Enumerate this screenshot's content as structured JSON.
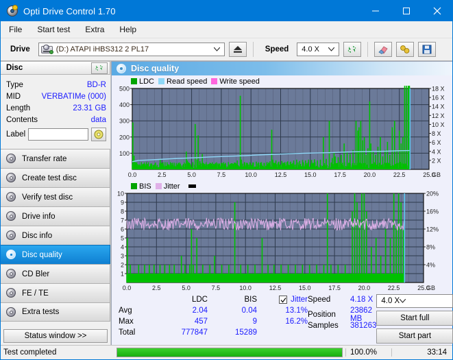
{
  "window": {
    "title": "Opti Drive Control 1.70",
    "icon": "disc-icon",
    "minimize": "–",
    "maximize": "□",
    "close": "✕"
  },
  "menu": {
    "items": [
      "File",
      "Start test",
      "Extra",
      "Help"
    ]
  },
  "toolbar": {
    "drive_label": "Drive",
    "drive_value": "(D:)  ATAPI iHBS312  2 PL17",
    "eject_icon": "eject-icon",
    "speed_label": "Speed",
    "speed_value": "4.0 X",
    "refresh_icon": "refresh-icon",
    "erase_icon": "eraser-icon",
    "key_icon": "key-icon",
    "save_icon": "save-icon"
  },
  "disc": {
    "header": "Disc",
    "refresh_icon": "refresh-icon",
    "rows": [
      {
        "key": "Type",
        "value": "BD-R"
      },
      {
        "key": "MID",
        "value": "VERBATIMe (000)"
      },
      {
        "key": "Length",
        "value": "23.31 GB"
      },
      {
        "key": "Contents",
        "value": "data"
      }
    ],
    "label_key": "Label",
    "label_value": "",
    "label_icon": "cd-icon"
  },
  "sidebar": {
    "items": [
      {
        "label": "Transfer rate",
        "active": false
      },
      {
        "label": "Create test disc",
        "active": false
      },
      {
        "label": "Verify test disc",
        "active": false
      },
      {
        "label": "Drive info",
        "active": false
      },
      {
        "label": "Disc info",
        "active": false
      },
      {
        "label": "Disc quality",
        "active": true
      },
      {
        "label": "CD Bler",
        "active": false
      },
      {
        "label": "FE / TE",
        "active": false
      },
      {
        "label": "Extra tests",
        "active": false
      }
    ],
    "status_button": "Status window >>"
  },
  "panel": {
    "title": "Disc quality",
    "icon": "disc-quality-icon"
  },
  "colors": {
    "accent": "#0078d7",
    "ldc": "#00a400",
    "bis": "#00c000",
    "read_speed": "#8fd8f8",
    "write_speed": "#ff66dd",
    "jitter": "#e0b0e8",
    "plot_bg": "#6b7a99",
    "grid": "#2e3a4d",
    "value_text": "#1a1aff",
    "progress": "#18ad11"
  },
  "chart_data": [
    {
      "type": "line",
      "title": "LDC / Read speed",
      "xlabel": "GB",
      "ylabel": "LDC errors",
      "legend": [
        {
          "label": "LDC",
          "color": "#00a400"
        },
        {
          "label": "Read speed",
          "color": "#8fd8f8"
        },
        {
          "label": "Write speed",
          "color": "#ff66dd"
        }
      ],
      "legend_position": "top-left",
      "grid": true,
      "xlim": [
        0,
        25
      ],
      "xticks": [
        "0.0",
        "2.5",
        "5.0",
        "7.5",
        "10.0",
        "12.5",
        "15.0",
        "17.5",
        "20.0",
        "22.5",
        "25.0"
      ],
      "xunit": "GB",
      "ylim": [
        0,
        500
      ],
      "yticks": [
        "100",
        "200",
        "300",
        "400",
        "500"
      ],
      "y2lim": [
        0,
        18
      ],
      "y2ticks": [
        "2 X",
        "4 X",
        "6 X",
        "8 X",
        "10 X",
        "12 X",
        "14 X",
        "16 X",
        "18 X"
      ],
      "scan_end_x": 23.4,
      "series": [
        {
          "name": "LDC",
          "type": "impulse",
          "x": [
            0.05,
            0.15,
            0.25,
            0.4,
            0.55,
            0.7,
            0.9,
            1.1,
            1.35,
            1.6,
            1.85,
            2.1,
            2.35,
            2.45,
            2.6,
            2.85,
            3.05,
            3.3,
            3.55,
            3.8,
            4.05,
            4.3,
            4.55,
            4.65,
            4.75,
            4.9,
            5.1,
            5.3,
            5.45,
            5.55,
            5.7,
            5.9,
            6.0,
            6.2,
            6.4,
            6.6,
            6.85,
            7.1,
            7.35,
            7.6,
            7.85,
            8.1,
            8.35,
            8.6,
            8.85,
            9.1,
            9.2,
            9.45,
            9.7,
            9.95,
            10.2,
            10.45,
            10.6,
            10.85,
            11.1,
            11.35,
            11.6,
            11.75,
            11.85,
            12.1,
            12.35,
            12.6,
            12.85,
            13.1,
            13.35,
            13.6,
            13.85,
            14.1,
            14.35,
            14.6,
            14.85,
            15.1,
            15.35,
            15.6,
            15.85,
            16.1,
            16.35,
            16.6,
            16.85,
            17.0,
            17.1,
            17.35,
            17.6,
            17.85,
            18.1,
            18.35,
            18.6,
            18.85,
            19.0,
            19.1,
            19.25,
            19.4,
            19.55,
            19.7,
            19.85,
            20.0,
            20.1,
            20.3,
            20.5,
            20.7,
            20.9,
            21.1,
            21.3,
            21.5,
            21.7,
            21.9,
            22.1,
            22.3,
            22.5,
            22.65,
            22.8,
            22.95,
            23.1,
            23.25,
            23.35
          ],
          "y": [
            290,
            85,
            45,
            30,
            25,
            20,
            22,
            18,
            20,
            25,
            30,
            28,
            65,
            32,
            25,
            22,
            28,
            24,
            30,
            26,
            35,
            30,
            110,
            55,
            40,
            30,
            45,
            280,
            60,
            210,
            50,
            95,
            40,
            35,
            32,
            38,
            30,
            28,
            35,
            32,
            40,
            45,
            38,
            42,
            55,
            455,
            60,
            45,
            40,
            38,
            42,
            48,
            38,
            44,
            40,
            45,
            50,
            245,
            60,
            55,
            48,
            52,
            45,
            50,
            48,
            55,
            60,
            52,
            58,
            55,
            60,
            58,
            62,
            55,
            60,
            200,
            65,
            300,
            70,
            105,
            80,
            75,
            90,
            160,
            110,
            95,
            120,
            300,
            240,
            260,
            300,
            180,
            200,
            90,
            130,
            420,
            160,
            110,
            90,
            140,
            200,
            80,
            120,
            170,
            90,
            260,
            300,
            120,
            240,
            160,
            200
          ]
        },
        {
          "name": "Read speed",
          "type": "line",
          "x": [
            0,
            0.5,
            1.5,
            2.5,
            3.5,
            4.5,
            5.5,
            6.5,
            7.5,
            8.5,
            9.5,
            10.5,
            11.5,
            12.5,
            13.5,
            14.5,
            15.5,
            16.5,
            17.5,
            18.5,
            19.5,
            20.5,
            21.5,
            22.5,
            23.35
          ],
          "y": [
            1.7,
            2.0,
            2.1,
            2.25,
            2.4,
            2.5,
            2.6,
            2.75,
            2.85,
            2.95,
            3.05,
            3.2,
            3.3,
            3.4,
            3.5,
            3.6,
            3.65,
            3.7,
            3.8,
            3.9,
            3.95,
            4.0,
            4.05,
            4.15,
            4.18
          ],
          "axis": "right"
        }
      ]
    },
    {
      "type": "line",
      "title": "BIS / Jitter",
      "xlabel": "GB",
      "ylabel": "BIS errors",
      "legend": [
        {
          "label": "BIS",
          "color": "#00a400"
        },
        {
          "label": "Jitter",
          "color": "#e0b0e8"
        }
      ],
      "legend_position": "top-left",
      "grid": true,
      "xlim": [
        0,
        25
      ],
      "xticks": [
        "0.0",
        "2.5",
        "5.0",
        "7.5",
        "10.0",
        "12.5",
        "15.0",
        "17.5",
        "20.0",
        "22.5",
        "25.0"
      ],
      "xunit": "GB",
      "ylim": [
        0,
        10
      ],
      "yticks": [
        "1",
        "2",
        "3",
        "4",
        "5",
        "6",
        "7",
        "8",
        "9",
        "10"
      ],
      "y2lim": [
        0,
        20
      ],
      "y2ticks": [
        "4%",
        "8%",
        "12%",
        "16%",
        "20%"
      ],
      "scan_end_x": 23.4,
      "series": [
        {
          "name": "BIS",
          "type": "impulse",
          "baseline": 1,
          "x": [
            0.05,
            0.3,
            1.0,
            1.5,
            1.9,
            2.3,
            2.8,
            3.2,
            3.6,
            4.0,
            4.6,
            4.9,
            5.3,
            5.45,
            5.6,
            5.9,
            6.4,
            7.0,
            7.4,
            8.0,
            8.6,
            9.1,
            9.6,
            10.2,
            10.8,
            11.4,
            11.9,
            12.4,
            13.0,
            13.6,
            14.2,
            14.8,
            15.4,
            16.0,
            16.6,
            16.9,
            17.2,
            17.8,
            18.4,
            19.0,
            19.2,
            19.4,
            19.6,
            19.8,
            20.0,
            20.2,
            20.6,
            21.0,
            21.4,
            21.8,
            22.2,
            22.5,
            22.7,
            22.9,
            23.1,
            23.3
          ],
          "y": [
            5,
            2,
            2,
            2,
            2,
            2,
            2,
            2,
            2,
            2,
            3,
            2,
            2,
            6,
            2,
            5,
            2,
            2,
            3,
            2,
            2,
            9,
            2,
            2,
            2,
            5,
            2,
            2,
            2,
            2,
            2,
            2,
            2,
            2,
            2,
            11,
            2,
            2,
            2,
            8,
            10,
            9,
            7,
            11,
            12,
            8,
            4,
            5,
            3,
            6,
            5,
            12,
            6,
            11,
            9,
            6
          ]
        },
        {
          "name": "Jitter",
          "type": "noise-line",
          "axis": "right",
          "mean": 13.1,
          "amplitude": 1.4,
          "xrange": [
            0,
            23.4
          ]
        }
      ]
    }
  ],
  "stats": {
    "columns": [
      "LDC",
      "BIS"
    ],
    "jitter_label": "Jitter",
    "jitter_checked": true,
    "rows": [
      {
        "label": "Avg",
        "ldc": "2.04",
        "bis": "0.04",
        "jitter": "13.1%"
      },
      {
        "label": "Max",
        "ldc": "457",
        "bis": "9",
        "jitter": "16.2%"
      },
      {
        "label": "Total",
        "ldc": "777847",
        "bis": "15289",
        "jitter": ""
      }
    ]
  },
  "results": {
    "speed_key": "Speed",
    "speed_value": "4.18 X",
    "position_key": "Position",
    "position_value": "23862 MB",
    "samples_key": "Samples",
    "samples_value": "381263",
    "speed_select": "4.0 X",
    "start_full": "Start full",
    "start_part": "Start part"
  },
  "statusbar": {
    "text": "Test completed",
    "percent": "100.0%",
    "progress": 100,
    "time": "33:14"
  }
}
